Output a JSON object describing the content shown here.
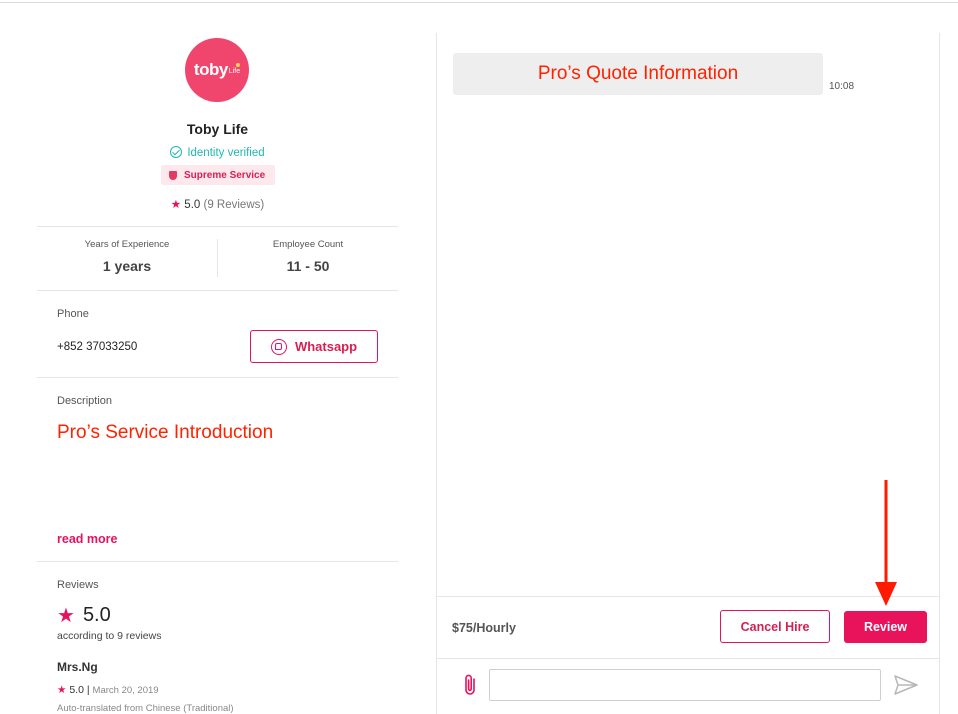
{
  "profile": {
    "logo_text": "toby",
    "logo_sub": "Life",
    "name": "Toby Life",
    "verified_label": "Identity verified",
    "badge_label": "Supreme Service",
    "rating": "5.0",
    "reviews_count_label": "(9 Reviews)"
  },
  "stats": {
    "experience_label": "Years of Experience",
    "experience_value": "1 years",
    "employee_label": "Employee Count",
    "employee_value": "11 - 50"
  },
  "phone": {
    "label": "Phone",
    "number": "+852 37033250",
    "whatsapp_label": "Whatsapp"
  },
  "description": {
    "label": "Description",
    "text": "Pro’s Service Introduction",
    "read_more": "read more"
  },
  "reviews": {
    "label": "Reviews",
    "score": "5.0",
    "according": "according to 9 reviews",
    "items": [
      {
        "name": "Mrs.Ng",
        "rating": "5.0",
        "separator": "|",
        "date": "March 20, 2019",
        "note": "Auto-translated from Chinese (Traditional)"
      }
    ]
  },
  "chat": {
    "message_text": "Pro’s Quote Information",
    "message_time": "10:08"
  },
  "quote": {
    "rate": "$75/Hourly",
    "cancel_label": "Cancel Hire",
    "review_label": "Review"
  },
  "composer": {
    "input_value": "",
    "input_placeholder": ""
  },
  "icons": {
    "star": "star-icon",
    "verified": "check-circle-icon",
    "badge": "shield-icon",
    "whatsapp": "whatsapp-icon",
    "attach": "paperclip-icon",
    "send": "send-icon"
  },
  "colors": {
    "brand": "#e6125e",
    "verified": "#22b6b0",
    "annotation": "#ff2200"
  }
}
